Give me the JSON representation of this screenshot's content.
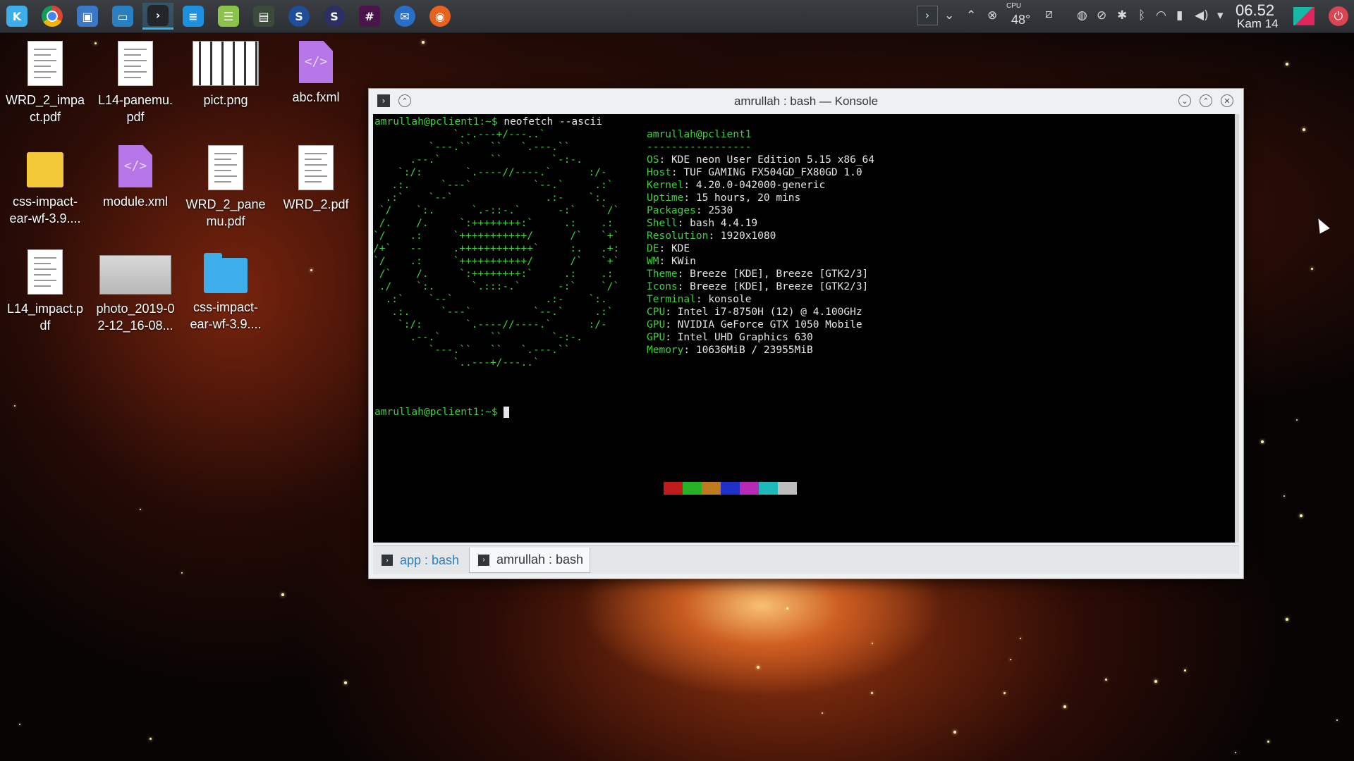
{
  "taskbar": {
    "launchers": [
      {
        "name": "kde-launcher-icon",
        "glyph": "K",
        "color": "#3daee9"
      },
      {
        "name": "chrome-icon",
        "glyph": "",
        "color": "#db4437"
      },
      {
        "name": "virtualbox-icon",
        "glyph": "▣",
        "color": "#3c78c8"
      },
      {
        "name": "file-manager-icon",
        "glyph": "▭",
        "color": "#2a7fc1"
      },
      {
        "name": "konsole-icon",
        "glyph": "›",
        "color": "#232629"
      },
      {
        "name": "text-editor-icon",
        "glyph": "≡",
        "color": "#1e90e0"
      },
      {
        "name": "database-tool-icon",
        "glyph": "☰",
        "color": "#8bc34a"
      },
      {
        "name": "nodejs-icon",
        "glyph": "▤",
        "color": "#3c4a3c"
      },
      {
        "name": "remote-app-icon",
        "glyph": "S",
        "color": "#1f4f9a"
      },
      {
        "name": "remote-app-2-icon",
        "glyph": "S",
        "color": "#2b2f64"
      },
      {
        "name": "slack-icon",
        "glyph": "#",
        "color": "#4a154b"
      },
      {
        "name": "thunderbird-icon",
        "glyph": "✉",
        "color": "#2a6fc7"
      },
      {
        "name": "firefox-icon",
        "glyph": "◉",
        "color": "#e8621f"
      }
    ],
    "cpu_label": "CPU",
    "cpu_temp": "48°",
    "clock_time": "06.52",
    "clock_date": "Kam 14"
  },
  "desktop_icons": [
    {
      "label": "WRD_2_impa ct.pdf",
      "type": "doc"
    },
    {
      "label": "L14-panemu. pdf",
      "type": "doc"
    },
    {
      "label": "pict.png",
      "type": "image"
    },
    {
      "label": "abc.fxml",
      "type": "xml"
    },
    {
      "label": "css-impact- ear-wf-3.9....",
      "type": "zip"
    },
    {
      "label": "module.xml",
      "type": "xml"
    },
    {
      "label": "WRD_2_pane mu.pdf",
      "type": "doc"
    },
    {
      "label": "WRD_2.pdf",
      "type": "doc"
    },
    {
      "label": "L14_impact.p df",
      "type": "doc"
    },
    {
      "label": "photo_2019-0 2-12_16-08...",
      "type": "photo"
    },
    {
      "label": "css-impact- ear-wf-3.9....",
      "type": "folder"
    }
  ],
  "window": {
    "title": "amrullah : bash — Konsole",
    "prompt": "amrullah@pclient1:~$",
    "command": "neofetch --ascii",
    "ascii_art": [
      "             `.-.---+/---..`",
      "         `---.``   ``   `.---.``",
      "      .--.`        ``        `-:-.",
      "    `:/:       `.----//----.`      :/-",
      "   .:.     `---`          `--.`     .:`",
      "  .:`    `--`               .:-    `:.",
      " `/    `:.      `.-::-.`      -:`    `/`",
      " /.    /.     `:++++++++:`     .:    .:",
      "`/    .:     `+++++++++++/      /`   `+`",
      "/+`   --     .++++++++++++`     :.   .+:",
      "`/    .:     `+++++++++++/      /`   `+`",
      " /`    /.     `:++++++++:`     .:    .:",
      " ./    `:.      `.:::-.`      -:`    `/`",
      "  .:`    `--`               .:-    `:.",
      "   .:.     `---`          `--.`     .:`",
      "    `:/:       `.----//----.`      :/-",
      "      .--.`        ``        `-:-.",
      "         `---.``   ``   `.---.``",
      "             `..---+/---..`"
    ],
    "user_host": "amrullah@pclient1",
    "separator": "-----------------",
    "info": [
      {
        "key": "OS",
        "value": "KDE neon User Edition 5.15 x86_64"
      },
      {
        "key": "Host",
        "value": "TUF GAMING FX504GD_FX80GD 1.0"
      },
      {
        "key": "Kernel",
        "value": "4.20.0-042000-generic"
      },
      {
        "key": "Uptime",
        "value": "15 hours, 20 mins"
      },
      {
        "key": "Packages",
        "value": "2530"
      },
      {
        "key": "Shell",
        "value": "bash 4.4.19"
      },
      {
        "key": "Resolution",
        "value": "1920x1080"
      },
      {
        "key": "DE",
        "value": "KDE"
      },
      {
        "key": "WM",
        "value": "KWin"
      },
      {
        "key": "Theme",
        "value": "Breeze [KDE], Breeze [GTK2/3]"
      },
      {
        "key": "Icons",
        "value": "Breeze [KDE], Breeze [GTK2/3]"
      },
      {
        "key": "Terminal",
        "value": "konsole"
      },
      {
        "key": "CPU",
        "value": "Intel i7-8750H (12) @ 4.100GHz"
      },
      {
        "key": "GPU",
        "value": "NVIDIA GeForce GTX 1050 Mobile"
      },
      {
        "key": "GPU",
        "value": "Intel UHD Graphics 630"
      },
      {
        "key": "Memory",
        "value": "10636MiB / 23955MiB"
      }
    ],
    "palette": [
      "#c01c1c",
      "#26b226",
      "#c07a1e",
      "#1f2fc8",
      "#b62ab6",
      "#1fb8b8",
      "#bdbdbd"
    ],
    "tabs": [
      {
        "label": "app : bash",
        "active": false
      },
      {
        "label": "amrullah : bash",
        "active": true
      }
    ]
  }
}
